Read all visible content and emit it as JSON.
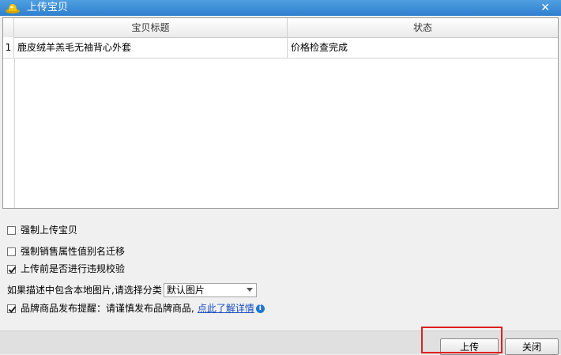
{
  "window": {
    "title": "上传宝贝"
  },
  "table": {
    "headers": [
      "宝贝标题",
      "状态"
    ],
    "rows": [
      {
        "index": "1",
        "title": "鹿皮绒羊羔毛无袖背心外套",
        "status": "价格检查完成"
      }
    ]
  },
  "options": {
    "force_upload": {
      "label": "强制上传宝贝",
      "checked": false
    },
    "force_alias_migrate": {
      "label": "强制销售属性值别名迁移",
      "checked": false
    },
    "violation_check": {
      "label": "上传前是否进行违规校验",
      "checked": true
    },
    "local_image_prompt": "如果描述中包含本地图片,请选择分类",
    "image_category": {
      "selected": "默认图片"
    },
    "brand_notice": {
      "label": "品牌商品发布提醒：请谨慎发布品牌商品,",
      "checked": true,
      "link_text": "点此了解详情"
    }
  },
  "buttons": {
    "upload": "上传",
    "close": "关闭"
  },
  "icons": {
    "app": "hat-icon",
    "close": "close-icon",
    "info": "info-icon"
  },
  "colors": {
    "titlebar": "#3a8bd6",
    "link": "#1a4ec0",
    "highlight": "#e02020"
  }
}
